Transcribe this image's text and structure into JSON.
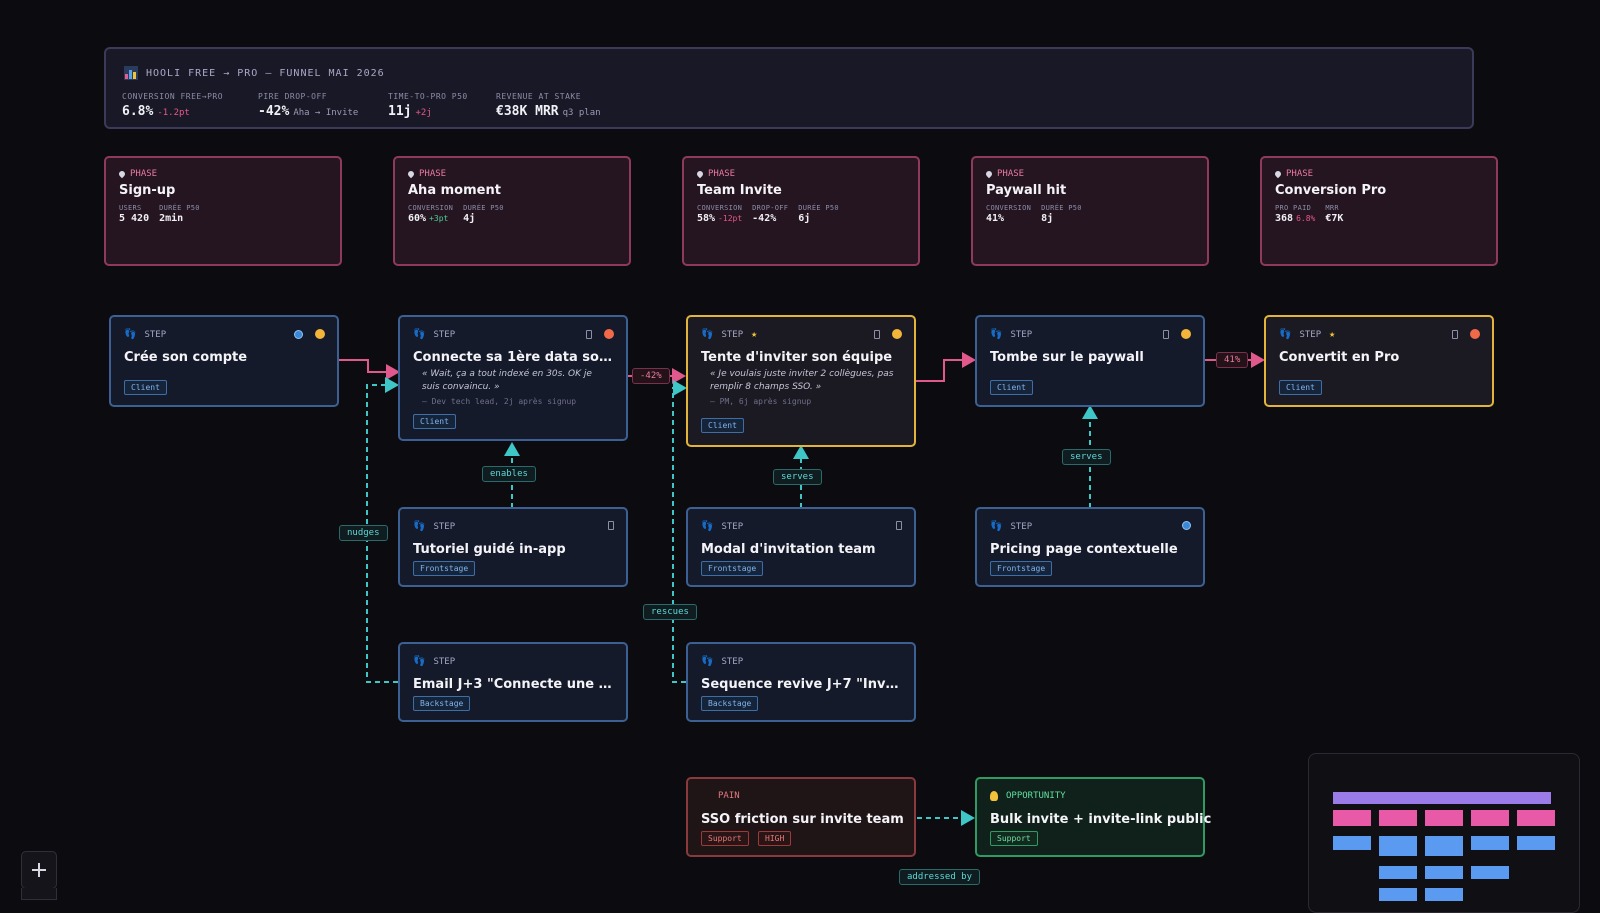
{
  "header": {
    "title": "HOOLI FREE → PRO — FUNNEL MAI 2026",
    "kpis": [
      {
        "label": "CONVERSION FREE→PRO",
        "value": "6.8%",
        "delta": "-1.2pt"
      },
      {
        "label": "PIRE DROP-OFF",
        "value": "-42%",
        "delta": "Aha → Invite"
      },
      {
        "label": "TIME-TO-PRO P50",
        "value": "11j",
        "delta": "+2j"
      },
      {
        "label": "REVENUE AT STAKE",
        "value": "€38K MRR",
        "delta": "q3 plan"
      }
    ]
  },
  "phases": [
    {
      "tag": "PHASE",
      "name": "Sign-up",
      "stats": [
        {
          "label": "USERS",
          "value": "5 420",
          "delta": ""
        },
        {
          "label": "DURÉE P50",
          "value": "2min",
          "delta": ""
        }
      ]
    },
    {
      "tag": "PHASE",
      "name": "Aha moment",
      "stats": [
        {
          "label": "CONVERSION",
          "value": "60%",
          "delta": "+3pt"
        },
        {
          "label": "DURÉE P50",
          "value": "4j",
          "delta": ""
        }
      ]
    },
    {
      "tag": "PHASE",
      "name": "Team Invite",
      "stats": [
        {
          "label": "CONVERSION",
          "value": "58%",
          "delta": "-12pt"
        },
        {
          "label": "DROP-OFF",
          "value": "-42%",
          "delta": ""
        },
        {
          "label": "DURÉE P50",
          "value": "6j",
          "delta": ""
        }
      ]
    },
    {
      "tag": "PHASE",
      "name": "Paywall hit",
      "stats": [
        {
          "label": "CONVERSION",
          "value": "41%",
          "delta": ""
        },
        {
          "label": "DURÉE P50",
          "value": "8j",
          "delta": ""
        }
      ]
    },
    {
      "tag": "PHASE",
      "name": "Conversion Pro",
      "stats": [
        {
          "label": "PRO PAID",
          "value": "368",
          "delta": "6.8%"
        },
        {
          "label": "MRR",
          "value": "€7K",
          "delta": ""
        }
      ]
    }
  ],
  "steps": {
    "tag": "STEP",
    "s1": {
      "title": "Crée son compte",
      "chip": "Client"
    },
    "s2": {
      "title": "Connecte sa 1ère data source",
      "quote": "« Wait, ça a tout indexé en 30s. OK je suis convaincu. »",
      "source": "— Dev tech lead, 2j après signup",
      "chip": "Client"
    },
    "s3": {
      "title": "Tente d'inviter son équipe",
      "quote": "« Je voulais juste inviter 2 collègues, pas remplir 8 champs SSO. »",
      "source": "— PM, 6j après signup",
      "chip": "Client"
    },
    "s4": {
      "title": "Tombe sur le paywall",
      "chip": "Client"
    },
    "s5": {
      "title": "Convertit en Pro",
      "chip": "Client"
    },
    "s6": {
      "title": "Tutoriel guidé in-app",
      "chip": "Frontstage"
    },
    "s7": {
      "title": "Modal d'invitation team",
      "chip": "Frontstage"
    },
    "s8": {
      "title": "Pricing page contextuelle",
      "chip": "Frontstage"
    },
    "s9": {
      "title": "Email J+3 \"Connecte une 2e s...",
      "chip": "Backstage"
    },
    "s10": {
      "title": "Sequence revive J+7 \"Invite t...",
      "chip": "Backstage"
    }
  },
  "pain": {
    "tag": "PAIN",
    "title": "SSO friction sur invite team",
    "chips": [
      "Support",
      "HIGH"
    ]
  },
  "opportunity": {
    "tag": "OPPORTUNITY",
    "title": "Bulk invite + invite-link public",
    "chip": "Support"
  },
  "edge_labels": {
    "drop1": "-42%",
    "drop2": "41%",
    "enables": "enables",
    "serves1": "serves",
    "serves2": "serves",
    "nudges": "nudges",
    "rescues": "rescues",
    "addressed": "addressed by"
  },
  "colors": {
    "phase_border": "#8f3a5c",
    "step_border": "#3c5f94",
    "highlight": "#e3b43c",
    "pain": "#8a3a3c",
    "opportunity": "#2f9a62",
    "edge_flow": "#e0588c",
    "edge_support": "#3fc6c6"
  },
  "icons": [
    "chart-icon",
    "pin-icon",
    "footprints-icon",
    "star-icon",
    "globe-icon",
    "emoji-icon",
    "phone-icon",
    "bulb-icon",
    "plus-icon"
  ]
}
